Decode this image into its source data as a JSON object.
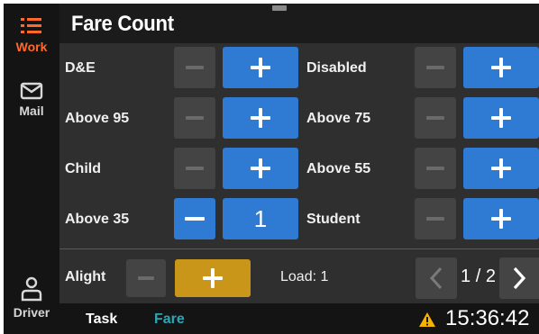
{
  "title": "Fare Count",
  "sidebar": {
    "items": [
      {
        "label": "Work",
        "icon": "list-icon",
        "active": true
      },
      {
        "label": "Mail",
        "icon": "mail-icon",
        "active": false
      },
      {
        "label": "Driver",
        "icon": "person-icon",
        "active": false
      }
    ]
  },
  "fares": [
    {
      "label": "D&E",
      "count": null
    },
    {
      "label": "Disabled",
      "count": null
    },
    {
      "label": "Above 95",
      "count": null
    },
    {
      "label": "Above 75",
      "count": null
    },
    {
      "label": "Child",
      "count": null
    },
    {
      "label": "Above 55",
      "count": null
    },
    {
      "label": "Above 35",
      "count": "1"
    },
    {
      "label": "Student",
      "count": null
    }
  ],
  "alight": {
    "label": "Alight"
  },
  "load": {
    "text": "Load: 1"
  },
  "pagination": {
    "text": "1 / 2"
  },
  "tabs": [
    {
      "label": "Task",
      "active": false
    },
    {
      "label": "Fare",
      "active": true
    }
  ],
  "status": {
    "time": "15:36:42",
    "warning_icon": "warning-icon"
  },
  "colors": {
    "accent_blue": "#2f7bd3",
    "active_orange": "#ff6a2b",
    "alight_gold": "#c9961a",
    "fare_tab_teal": "#2aa6b5",
    "warning_yellow": "#f5b400"
  }
}
